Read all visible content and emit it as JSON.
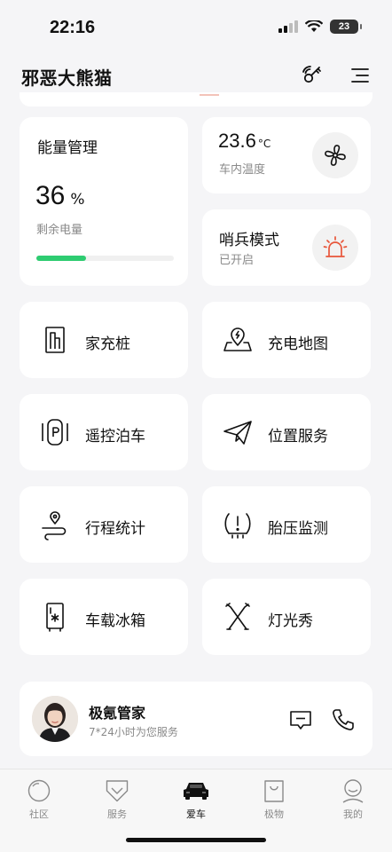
{
  "status": {
    "time": "22:16",
    "battery": "23"
  },
  "header": {
    "car_name": "邪恶大熊猫"
  },
  "energy": {
    "title": "能量管理",
    "value": "36",
    "unit": "%",
    "label": "剩余电量",
    "level": 0.36,
    "bar_color": "#2ecc71"
  },
  "climate": {
    "temp": "23.6",
    "unit": "°C",
    "label": "车内温度"
  },
  "sentry": {
    "title": "哨兵模式",
    "status": "已开启",
    "accent": "#e8563a"
  },
  "tiles": {
    "home_charger": "家充桩",
    "charging_map": "充电地图",
    "remote_parking": "遥控泊车",
    "location_service": "位置服务",
    "trip_stats": "行程统计",
    "tire_pressure": "胎压监测",
    "car_fridge": "车载冰箱",
    "light_show": "灯光秀"
  },
  "butler": {
    "name": "极氪管家",
    "desc": "7*24小时为您服务"
  },
  "tabs": [
    {
      "label": "社区",
      "icon": "community-icon"
    },
    {
      "label": "服务",
      "icon": "service-icon"
    },
    {
      "label": "爱车",
      "icon": "car-icon"
    },
    {
      "label": "极物",
      "icon": "shop-bag-icon"
    },
    {
      "label": "我的",
      "icon": "profile-icon"
    }
  ]
}
